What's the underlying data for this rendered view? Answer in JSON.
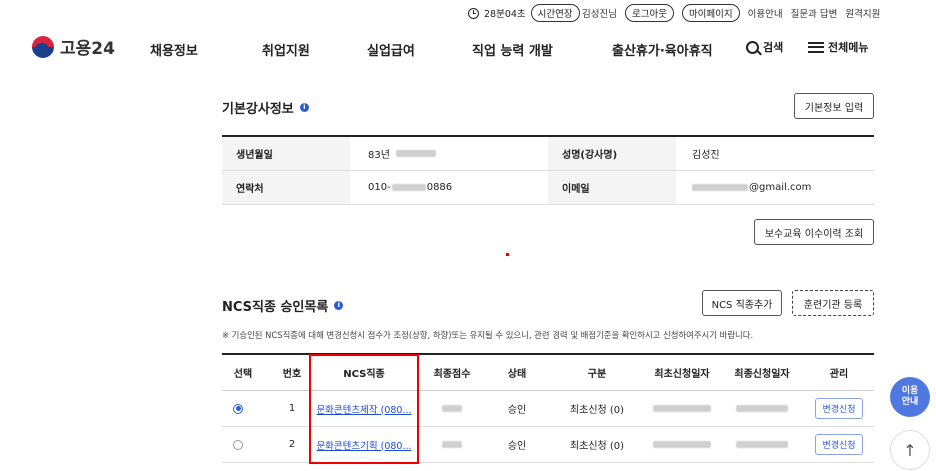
{
  "util": {
    "timer": "28분04초",
    "extend": "시간연장",
    "user": "김성진님",
    "logout": "로그아웃",
    "mypage": "마이페이지",
    "guide": "이용안내",
    "qna": "질문과 답변",
    "remote": "원격지원"
  },
  "header": {
    "logo": "고용24",
    "nav": [
      "채용정보",
      "취업지원",
      "실업급여",
      "직업 능력 개발",
      "출산휴가·육아휴직"
    ],
    "search": "검색",
    "menu": "전체메뉴"
  },
  "basic": {
    "title": "기본강사정보",
    "input_btn": "기본정보 입력",
    "rows": [
      {
        "label1": "생년월일",
        "value1": "83년",
        "label2": "성명(강사명)",
        "value2": "김성진"
      },
      {
        "label1": "연락처",
        "value1_pre": "010-",
        "value1_post": "0886",
        "label2": "이메일",
        "value2_post": "@gmail.com"
      }
    ],
    "history_btn": "보수교육 이수이력 조회"
  },
  "ncs": {
    "title": "NCS직종 승인목록",
    "add_btn": "NCS 직종추가",
    "register_btn": "훈련기관 등록",
    "notice": "※ 기승인된 NCS직종에 대해 변경신청시 점수가 조정(상향, 하향)또는 유지될 수 있으니, 관련 경력 및 배점기준을 확인하시고 신청하여주시기 바랍니다.",
    "headers": [
      "선택",
      "번호",
      "NCS직종",
      "최종점수",
      "상태",
      "구분",
      "최초신청일자",
      "최종신청일자",
      "관리"
    ],
    "rows": [
      {
        "selected": true,
        "no": "1",
        "name": "문화콘텐츠제작 (080...",
        "status": "승인",
        "type": "최초신청 (0)",
        "action": "변경신청"
      },
      {
        "selected": false,
        "no": "2",
        "name": "문화콘텐츠기획 (080...",
        "status": "승인",
        "type": "최초신청 (0)",
        "action": "변경신청"
      }
    ]
  },
  "floating": {
    "guide_line1": "이용",
    "guide_line2": "안내",
    "top_arrow": "↑"
  },
  "colors": {
    "accent": "#2b5ad9",
    "highlight": "#ee0000",
    "guide_bg": "#4f79e0"
  }
}
